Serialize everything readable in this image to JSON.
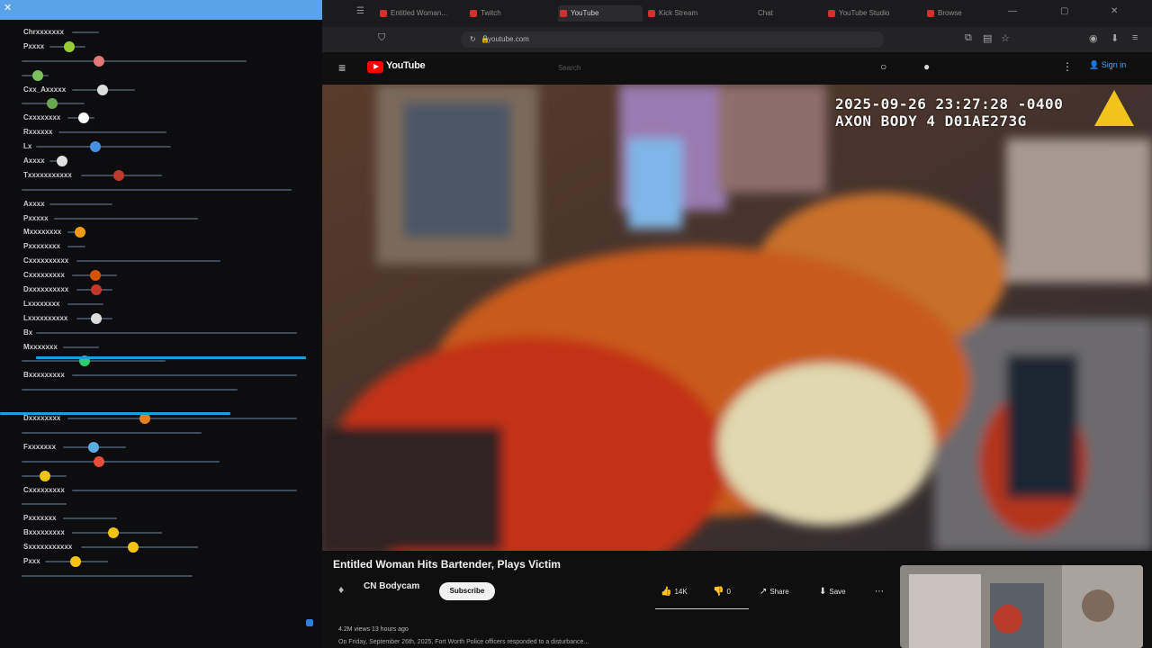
{
  "chat": {
    "messages": [
      {
        "user": "Chrxxxxxxx",
        "len": 30,
        "emote": "",
        "ecol": ""
      },
      {
        "user": "Pxxxx",
        "len": 40,
        "emote": "green-face",
        "ecol": "#9acd32"
      },
      {
        "user": "",
        "len": 250,
        "emote": "pink-face",
        "ecol": "#e07a7a"
      },
      {
        "user": "",
        "len": 30,
        "emote": "green-face",
        "ecol": "#7cbf5c"
      },
      {
        "user": "Cxx_Axxxxx",
        "len": 70,
        "emote": "hand",
        "ecol": "#dddddd"
      },
      {
        "user": "",
        "len": 70,
        "emote": "pepe",
        "ecol": "#6aa84f"
      },
      {
        "user": "Cxxxxxxxx",
        "len": 30,
        "emote": "white-dot",
        "ecol": "#ffffff"
      },
      {
        "user": "Rxxxxxx",
        "len": 120,
        "emote": "",
        "ecol": ""
      },
      {
        "user": "Lx",
        "len": 150,
        "emote": "blue-cube",
        "ecol": "#4a90e2"
      },
      {
        "user": "Axxxx",
        "len": 20,
        "emote": "ghost",
        "ecol": "#e0e0e0"
      },
      {
        "user": "Txxxxxxxxxxx",
        "len": 90,
        "emote": "red-dot",
        "ecol": "#c0392b"
      },
      {
        "user": "",
        "len": 300,
        "emote": "",
        "ecol": ""
      },
      {
        "user": "Axxxx",
        "len": 70,
        "emote": "",
        "ecol": ""
      },
      {
        "user": "Pxxxxx",
        "len": 160,
        "emote": "",
        "ecol": ""
      },
      {
        "user": "Mxxxxxxxx",
        "len": 20,
        "emote": "fire",
        "ecol": "#f39c12"
      },
      {
        "user": "Pxxxxxxxx",
        "len": 20,
        "emote": "",
        "ecol": ""
      },
      {
        "user": "Cxxxxxxxxxx",
        "len": 160,
        "emote": "",
        "ecol": ""
      },
      {
        "user": "Cxxxxxxxxx",
        "len": 50,
        "emote": "cat",
        "ecol": "#d35400"
      },
      {
        "user": "Dxxxxxxxxxx",
        "len": 40,
        "emote": "face",
        "ecol": "#c0392b"
      },
      {
        "user": "Lxxxxxxxx",
        "len": 40,
        "emote": "",
        "ecol": ""
      },
      {
        "user": "Lxxxxxxxxxx",
        "len": 40,
        "emote": "hand",
        "ecol": "#dddddd"
      },
      {
        "user": "Bx",
        "len": 290,
        "emote": "",
        "ecol": ""
      },
      {
        "user": "Mxxxxxxx",
        "len": 40,
        "emote": "",
        "ecol": ""
      },
      {
        "user": "",
        "len": 160,
        "emote": "pepe",
        "ecol": "#2ecc71"
      },
      {
        "user": "Bxxxxxxxxx",
        "len": 280,
        "emote": "",
        "ecol": ""
      },
      {
        "user": "",
        "len": 240,
        "emote": "",
        "ecol": ""
      },
      {
        "user": "",
        "len": 0,
        "emote": "",
        "ecol": ""
      },
      {
        "user": "Dxxxxxxxx",
        "len": 290,
        "emote": "emotes",
        "ecol": "#e67e22"
      },
      {
        "user": "",
        "len": 200,
        "emote": "",
        "ecol": ""
      },
      {
        "user": "Fxxxxxxx",
        "len": 70,
        "emote": "doge",
        "ecol": "#5dade2"
      },
      {
        "user": "",
        "len": 220,
        "emote": "ring",
        "ecol": "#e74c3c"
      },
      {
        "user": "",
        "len": 50,
        "emote": "yellow-face",
        "ecol": "#f1c40f"
      },
      {
        "user": "Cxxxxxxxxx",
        "len": 290,
        "emote": "",
        "ecol": ""
      },
      {
        "user": "",
        "len": 50,
        "emote": "",
        "ecol": ""
      },
      {
        "user": "Pxxxxxxx",
        "len": 60,
        "emote": "",
        "ecol": ""
      },
      {
        "user": "Bxxxxxxxxx",
        "len": 100,
        "emote": "yellow-face",
        "ecol": "#f1c40f"
      },
      {
        "user": "Sxxxxxxxxxxx",
        "len": 130,
        "emote": "yellow-face",
        "ecol": "#f1c40f"
      },
      {
        "user": "Pxxx",
        "len": 70,
        "emote": "yellow-face",
        "ecol": "#f1c40f"
      },
      {
        "user": "",
        "len": 190,
        "emote": "",
        "ecol": ""
      }
    ]
  },
  "browser": {
    "tabs": [
      {
        "label": "Entitled Woman...",
        "active": false
      },
      {
        "label": "Twitch",
        "active": false
      },
      {
        "label": "YouTube",
        "active": true
      },
      {
        "label": "Kick Stream",
        "active": false
      },
      {
        "label": "Chat",
        "active": false
      },
      {
        "label": "YouTube Studio",
        "active": false
      },
      {
        "label": "Browse",
        "active": false
      }
    ],
    "url": "youtube.com"
  },
  "youtube": {
    "logo_text": "YouTube",
    "search_placeholder": "Search",
    "signin_label": "Sign in",
    "overlay_line1": "2025-09-26 23:27:28 -0400",
    "overlay_line2": "AXON BODY 4 D01AE273G",
    "video_title": "Entitled Woman Hits Bartender, Plays Victim",
    "channel_name": "CN Bodycam",
    "subscribe_label": "Subscribe",
    "actions": [
      {
        "icon": "👍",
        "label": "14K"
      },
      {
        "icon": "👎",
        "label": "0"
      },
      {
        "icon": "↗",
        "label": "Share"
      },
      {
        "icon": "⬇",
        "label": "Save"
      },
      {
        "icon": "⋯",
        "label": ""
      }
    ],
    "meta": "4.2M views  13 hours ago",
    "description": "On Friday, September 26th, 2025, Fort Worth Police officers responded to a disturbance..."
  },
  "colors": {
    "accent": "#3ea6ff",
    "brand_red": "#ff0000",
    "chat_highlight": "#1a9fd8",
    "chat_top": "#5aa3e8"
  }
}
